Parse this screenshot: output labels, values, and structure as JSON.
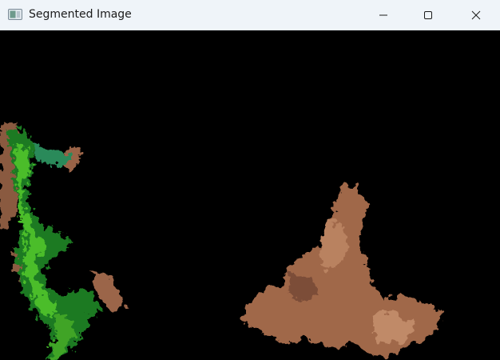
{
  "window": {
    "title": "Segmented Image",
    "icons": {
      "app": "app-image-icon",
      "minimize": "minimize-icon",
      "maximize": "maximize-icon",
      "close": "close-icon"
    }
  },
  "image": {
    "background": "#000000",
    "regions": [
      {
        "name": "green-vegetation-region",
        "color": "#2fa81f"
      },
      {
        "name": "brown-soil-region-left",
        "color": "#a46a4a"
      },
      {
        "name": "brown-soil-region-right",
        "color": "#b07a5a"
      }
    ]
  }
}
